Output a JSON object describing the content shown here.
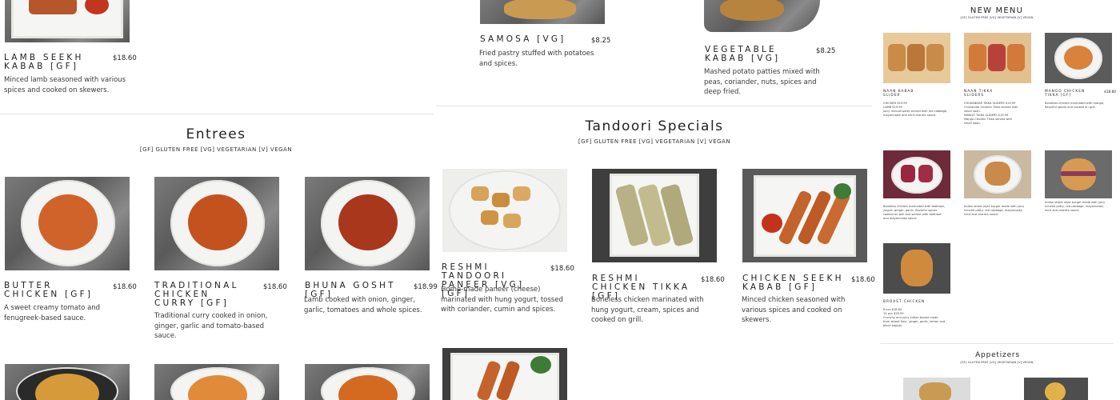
{
  "top_row": [
    {
      "name": "Lamb Seekh Kabab [GF]",
      "price": "$18.60",
      "desc": "Minced lamb seasoned with various spices and cooked on skewers."
    },
    {
      "name": "Samosa [VG]",
      "price": "$8.25",
      "desc": "Fried pastry stuffed with potatoes and spices."
    },
    {
      "name": "Vegetable Kabab [VG]",
      "price": "$8.25",
      "desc": "Mashed potato patties mixed with peas, coriander, nuts, spices and deep fried."
    }
  ],
  "entrees": {
    "title": "Entrees",
    "subtitle": "[GF] GLUTEN FREE [VG] VEGETARIAN [V] VEGAN",
    "items": [
      {
        "name": "Butter Chicken [GF]",
        "price": "$18.60",
        "desc": "A sweet creamy tomato and fenugreek-based sauce."
      },
      {
        "name": "Traditional Chicken Curry [GF]",
        "price": "$18.60",
        "desc": "Traditional curry cooked in onion, ginger, garlic and tomato-based sauce."
      },
      {
        "name": "Bhuna Gosht [GF]",
        "price": "$18.99",
        "desc": "Lamb cooked with onion, ginger, garlic, tomatoes and whole spices."
      }
    ]
  },
  "tandoori": {
    "title": "Tandoori Specials",
    "subtitle": "[GF] GLUTEN FREE [VG] VEGETARIAN [V] VEGAN",
    "items": [
      {
        "name": "Reshmi Tandoori Paneer [VG] [GF]",
        "price": "$18.60",
        "desc": "Home-made paneer (cheese) marinated with hung yogurt, tossed with coriander, cumin and spices."
      },
      {
        "name": "Reshmi Chicken Tikka [GF]",
        "price": "$18.60",
        "desc": "Boneless chicken marinated with hung yogurt, cream, spices and cooked on grill."
      },
      {
        "name": "Chicken Seekh Kabab [GF]",
        "price": "$18.60",
        "desc": "Minced chicken seasoned with various spices and cooked on skewers."
      }
    ]
  },
  "new_menu": {
    "title": "NEW MENU",
    "subtitle": "[GF] GLUTEN FREE [VG] VEGETARIAN [V] VEGAN",
    "items": [
      {
        "name": "Naan Kabab Slider",
        "price": "",
        "desc": "CHICKEN $19.99\nLAMB $19.99\nJuicy minced patty served with red cabbage,\nmayonnaise and mint cilantro sauce."
      },
      {
        "name": "Naan Tikka Sliders",
        "price": "",
        "desc": "CHUKANDAR TIKKA SLIDERS $19.99\nChukandar Chicken Tikka served with\nsmall naan.\nMANGO TIKKA SLIDERS $19.99\nMango Chicken Tikka served with\nsmall naan."
      },
      {
        "name": "Mango Chicken Tikka [GF]",
        "price": "$18.60",
        "desc": "Boneless chicken marinated with mango,\nflavorful spices and cooked on grill."
      },
      {
        "name": "",
        "price": "",
        "desc": "Boneless chicken marinated with beetroot,\nyogurt, ginger, garlic, flavorful spices\ncooked on grill and served with beetroot\nand mayonnaise sauce."
      },
      {
        "name": "",
        "price": "",
        "desc": "Indian street style burger made with juicy\nminced patty, red cabbage, mayonnaise,\nmint and cilantro sauce."
      },
      {
        "name": "",
        "price": "",
        "desc": "Indian street style burger made with juicy\nminced patty, red cabbage, mayonnaise,\nmint and cilantro sauce."
      },
      {
        "name": "Broast Chicken",
        "price": "",
        "desc": "6 pcs $18.60\n10 pcs $28.99\nCrunchy and juicy Indian broast made\nfrom wheat flour, ginger, garlic, lemon and\nblack pepper."
      }
    ]
  },
  "appetizers": {
    "title": "Appetizers",
    "subtitle": "[GF] GLUTEN FREE [VG] VEGETARIAN [V] VEGAN"
  }
}
